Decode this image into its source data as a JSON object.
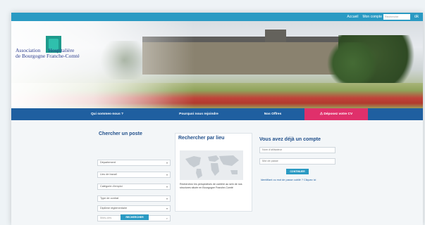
{
  "topbar": {
    "links": [
      "Accueil",
      "Mon compte"
    ],
    "search_placeholder": "Recherche",
    "search_button": "ok"
  },
  "header": {
    "logo_line1": "Association      Hospitalière",
    "logo_line2": "de Bourgogne Franche-Comté"
  },
  "nav": {
    "items": [
      "Qui sommes-nous ?",
      "Pourquoi nous rejoindre",
      "Nos Offres",
      "Déposez votre CV"
    ]
  },
  "search_job": {
    "title": "Chercher un poste",
    "selects": [
      "Département",
      "Lieu de travail",
      "Catégorie d'emploi",
      "Type de contrat",
      "Diplôme réglementaire"
    ],
    "keyword_placeholder": "Mots-clés",
    "button": "RECHERCHER"
  },
  "search_place": {
    "title": "Rechercher par lieu",
    "description": "Recherchez les perspectives de carrière au sein de nos structures située en Bourgogne Franche-Comté"
  },
  "account": {
    "title": "Vous avez déjà un compte",
    "username_placeholder": "Nom d'utilisateur",
    "password_placeholder": "Mot de passe",
    "button": "CONTINUER",
    "forgot": "Identifiant ou mot de passe oublié ? Cliquez ici"
  },
  "colors": {
    "topbar": "#2a9ac3",
    "nav": "#1f5fa0",
    "cv_button": "#e0306b",
    "logo": "#1e9a8c"
  }
}
